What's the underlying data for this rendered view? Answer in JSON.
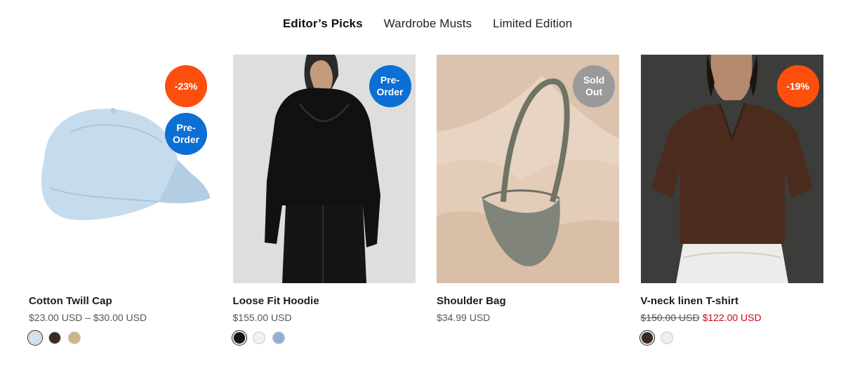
{
  "tabs": [
    {
      "label": "Editor’s Picks"
    },
    {
      "label": "Wardrobe Musts"
    },
    {
      "label": "Limited Edition"
    }
  ],
  "products": [
    {
      "title": "Cotton Twill Cap",
      "price": "$23.00 USD – $30.00 USD",
      "badges": [
        {
          "text": "-23%"
        },
        {
          "text": "Pre-\nOrder"
        }
      ],
      "swatches": [
        {
          "color": "#cfe3f0"
        },
        {
          "color": "#3a2a22"
        },
        {
          "color": "#cdb58a"
        }
      ]
    },
    {
      "title": "Loose Fit Hoodie",
      "price": "$155.00 USD",
      "badges": [
        {
          "text": "Pre-\nOrder"
        }
      ],
      "swatches": [
        {
          "color": "#141414"
        },
        {
          "color": "#f3f1ec"
        },
        {
          "color": "#8fb0d8"
        }
      ]
    },
    {
      "title": "Shoulder Bag",
      "price": "$34.99 USD",
      "badges": [
        {
          "text": "Sold\nOut"
        }
      ],
      "swatches": []
    },
    {
      "title": "V-neck linen T-shirt",
      "price_compare": "$150.00 USD",
      "price_sale": "$122.00 USD",
      "badges": [
        {
          "text": "-19%"
        }
      ],
      "swatches": [
        {
          "color": "#3b2a20"
        },
        {
          "color": "#efeeea"
        }
      ]
    }
  ],
  "colors": {
    "sale_badge": "#fc4f0e",
    "preorder_badge": "#0b6fd6",
    "soldout_badge": "#9a9a9a",
    "sale_price": "#d0021b"
  }
}
